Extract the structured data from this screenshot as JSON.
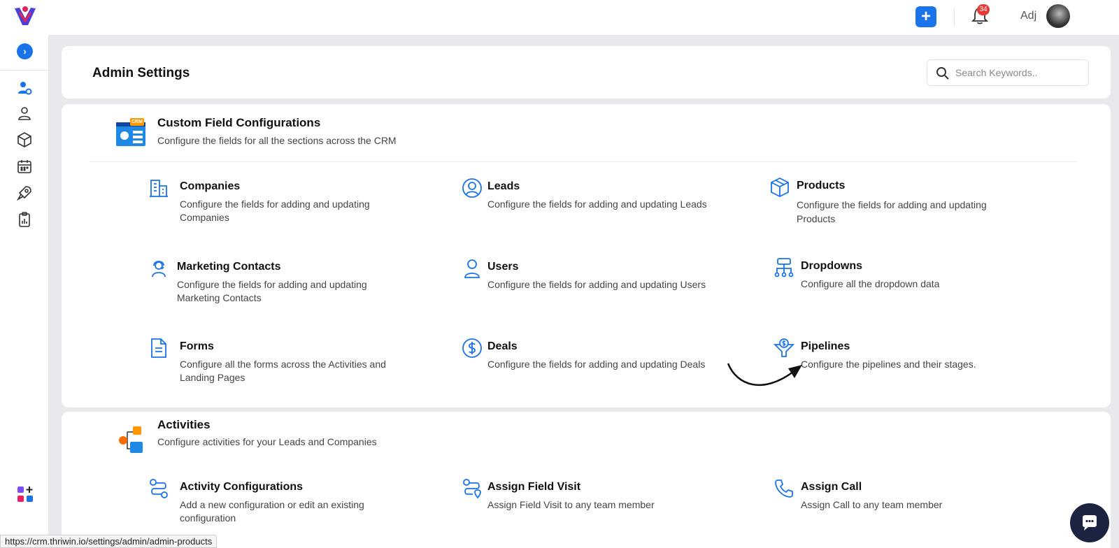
{
  "topbar": {
    "notification_count": "34",
    "user_name": "Adj"
  },
  "sidebar": {
    "items": [
      {
        "icon": "user-settings-icon"
      },
      {
        "icon": "user-icon"
      },
      {
        "icon": "cube-icon"
      },
      {
        "icon": "calendar-icon"
      },
      {
        "icon": "rocket-icon"
      },
      {
        "icon": "clipboard-chart-icon"
      },
      {
        "icon": "apps-add-icon"
      }
    ]
  },
  "header": {
    "title": "Admin Settings",
    "search_placeholder": "Search Keywords.."
  },
  "custom_fields": {
    "title": "Custom Field Configurations",
    "description": "Configure the fields for all the sections across the CRM",
    "badge": "CRM",
    "items": [
      {
        "title": "Companies",
        "description": "Configure the fields for adding and updating Companies",
        "icon": "building-icon"
      },
      {
        "title": "Leads",
        "description": "Configure the fields for adding and updating Leads",
        "icon": "user-circle-icon"
      },
      {
        "title": "Products",
        "description": "Configure the fields for adding and updating Products",
        "icon": "box-icon"
      },
      {
        "title": "Marketing Contacts",
        "description": "Configure the fields for adding and updating Marketing Contacts",
        "icon": "headset-user-icon"
      },
      {
        "title": "Users",
        "description": "Configure the fields for adding and updating Users",
        "icon": "user-icon"
      },
      {
        "title": "Dropdowns",
        "description": "Configure all the dropdown data",
        "icon": "hierarchy-icon"
      },
      {
        "title": "Forms",
        "description": "Configure all the forms across the Activities and Landing Pages",
        "icon": "document-icon"
      },
      {
        "title": "Deals",
        "description": "Configure the fields for adding and updating Deals",
        "icon": "dollar-circle-icon"
      },
      {
        "title": "Pipelines",
        "description": "Configure the pipelines and their stages.",
        "icon": "funnel-dollar-icon"
      }
    ]
  },
  "activities": {
    "title": "Activities",
    "description": "Configure activities for your Leads and Companies",
    "items": [
      {
        "title": "Activity Configurations",
        "description": "Add a new configuration or edit an existing configuration",
        "icon": "route-icon"
      },
      {
        "title": "Assign Field Visit",
        "description": "Assign Field Visit to any team member",
        "icon": "route-pin-icon"
      },
      {
        "title": "Assign Call",
        "description": "Assign Call to any team member",
        "icon": "phone-icon"
      }
    ]
  },
  "status_bar": {
    "url": "https://crm.thriwin.io/settings/admin/admin-products"
  },
  "colors": {
    "accent": "#1a73e8",
    "badge": "#e53935",
    "chat": "#1c2340",
    "icon_stroke": "#1a73e8"
  }
}
